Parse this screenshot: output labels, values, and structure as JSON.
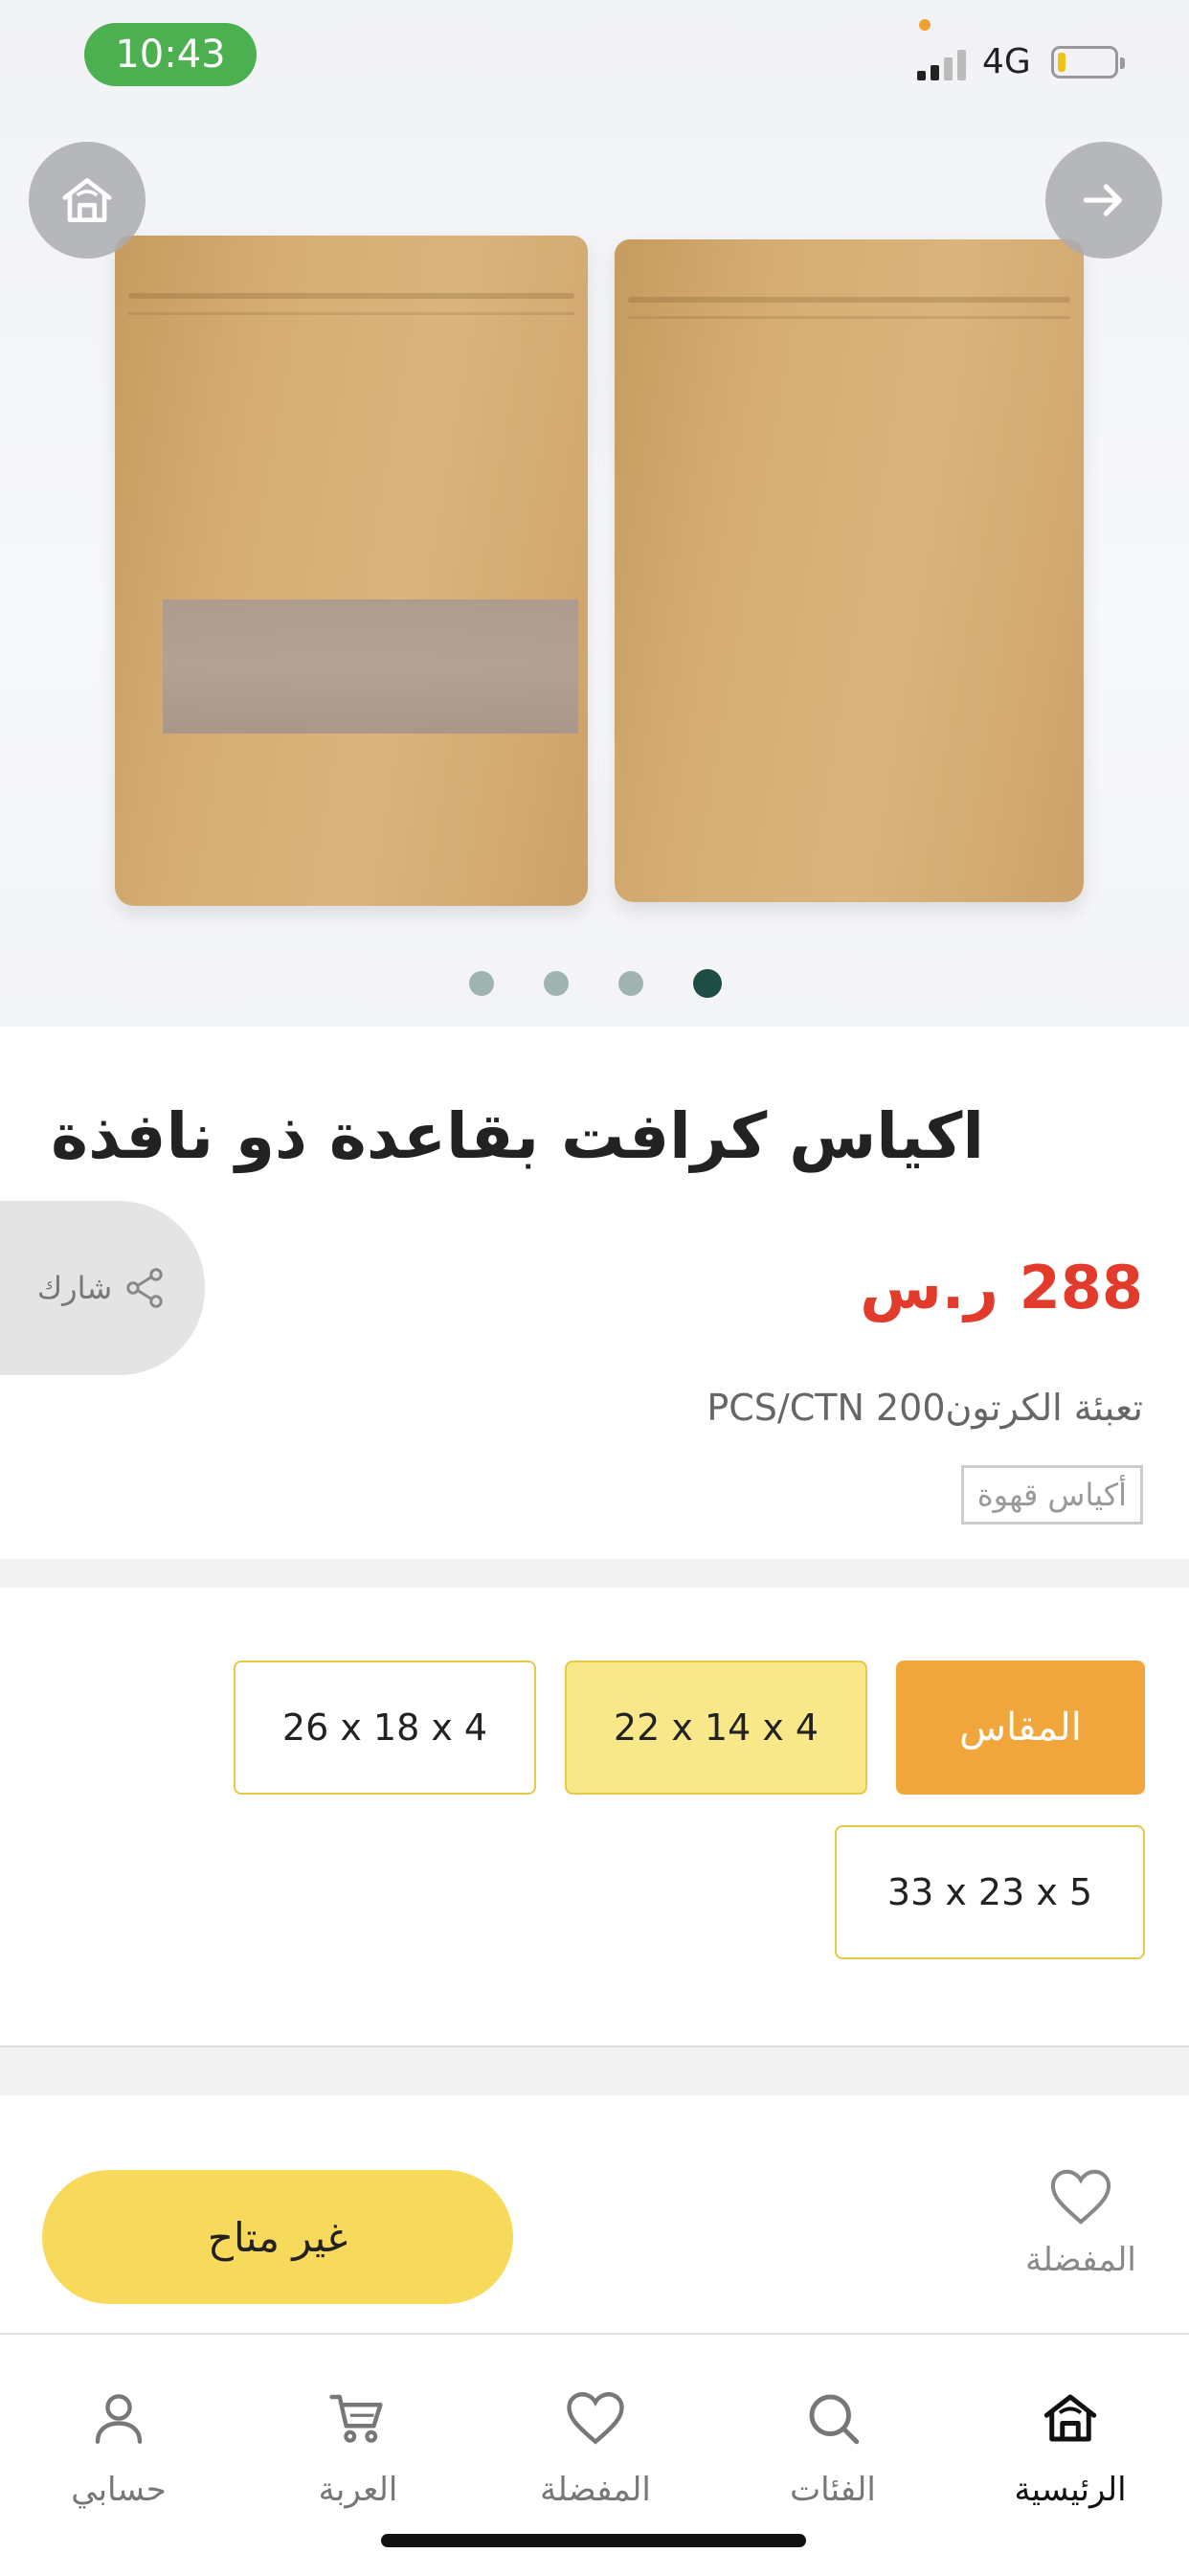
{
  "status_bar": {
    "time": "10:43",
    "network": "4G"
  },
  "product": {
    "title": "اكياس كرافت بقاعدة ذو نافذة",
    "price": "288 ر.س",
    "packing": "تعبئة الكرتون200 PCS/CTN",
    "tag": "أكياس قهوة",
    "share_label": "شارك",
    "carousel": {
      "total": 4,
      "active_index": 3
    }
  },
  "sizes": {
    "label": "المقاس",
    "options": [
      "22 x 14 x 4",
      "26 x 18 x 4",
      "33 x  23 x 5"
    ],
    "selected": "22 x 14 x 4"
  },
  "actions": {
    "unavailable_label": "غير متاح",
    "favorite_label": "المفضلة"
  },
  "bottom_nav": {
    "items": [
      {
        "label": "الرئيسية",
        "icon": "home-icon",
        "active": true
      },
      {
        "label": "الفئات",
        "icon": "search-icon"
      },
      {
        "label": "المفضلة",
        "icon": "heart-icon"
      },
      {
        "label": "العربة",
        "icon": "cart-icon"
      },
      {
        "label": "حسابي",
        "icon": "user-icon"
      }
    ]
  },
  "colors": {
    "status_pill": "#4caf50",
    "price": "#e23b2b",
    "size_label_bg": "#f0a63a",
    "selected_size_bg": "#f8e88a",
    "unavailable_btn": "#f7da5c",
    "carousel_active_dot": "#1e4d45"
  }
}
